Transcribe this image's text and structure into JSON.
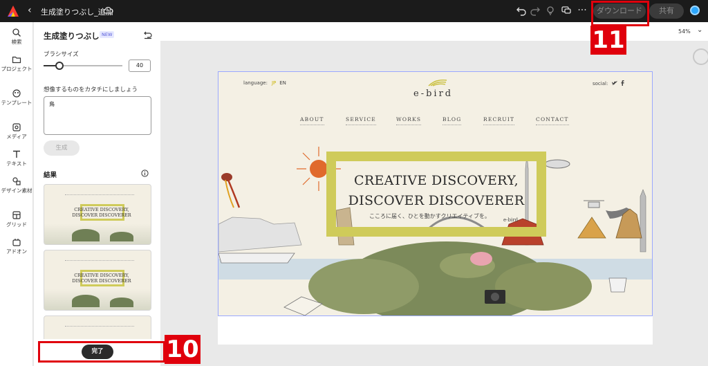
{
  "topbar": {
    "back_glyph": "‹",
    "doc_title": "生成塗りつぶし_追加",
    "download_label": "ダウンロード",
    "share_label": "共有",
    "more_glyph": "···",
    "icons": [
      "adobe-express-logo",
      "cloud-icon",
      "undo-icon",
      "redo-icon",
      "lightbulb-icon",
      "comment-icon",
      "more-icon"
    ]
  },
  "rail": {
    "items": [
      {
        "label": "検索",
        "icon": "search-icon"
      },
      {
        "label": "プロジェクト",
        "icon": "folder-icon"
      },
      {
        "label": "テンプレート",
        "icon": "template-icon"
      },
      {
        "label": "メディア",
        "icon": "media-icon"
      },
      {
        "label": "テキスト",
        "icon": "text-icon"
      },
      {
        "label": "デザイン素材",
        "icon": "shapes-icon"
      },
      {
        "label": "グリッド",
        "icon": "grid-icon"
      },
      {
        "label": "アドオン",
        "icon": "addon-icon"
      }
    ]
  },
  "panel": {
    "title": "生成塗りつぶし",
    "badge": "NEW",
    "brush_label": "ブラシサイズ",
    "brush_value": "40",
    "brush_level": 0.2,
    "prompt_label": "想像するものをカタチにしましょう",
    "prompt_value": "鳥",
    "generate_label": "生成",
    "results_label": "結果",
    "done_label": "完了",
    "thumb_line1": "CREATIVE DISCOVERY,",
    "thumb_line2": "DISCOVER DISCOVERER"
  },
  "canvas": {
    "zoom": "54%",
    "zoom_chevron": "⌄"
  },
  "site": {
    "language_label": "language:",
    "lang_jp": "JP",
    "lang_en": "EN",
    "social_label": "social:",
    "brand": "e-bird",
    "nav": [
      "ABOUT",
      "SERVICE",
      "WORKS",
      "BLOG",
      "RECRUIT",
      "CONTACT"
    ],
    "hero_line1": "CREATIVE DISCOVERY,",
    "hero_line2": "DISCOVER DISCOVERER",
    "hero_sub": "こころに届く、ひとを動かすクリエイティブを。",
    "hero_logo": "e-bird"
  },
  "annotations": {
    "done_number": "10",
    "download_number": "11",
    "color": "#e0000c"
  },
  "colors": {
    "accent_frame": "#cfcb5a",
    "topbar": "#1b1b1b",
    "selection": "#9aa8ff"
  }
}
